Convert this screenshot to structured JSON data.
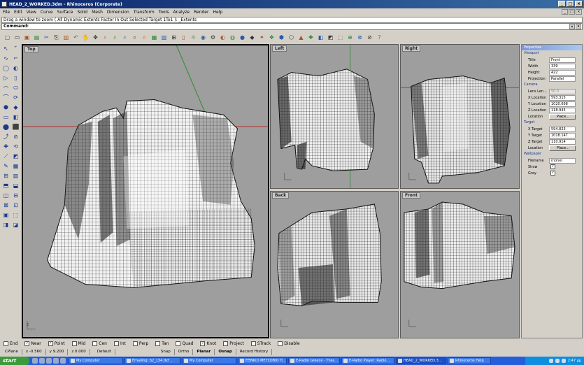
{
  "window": {
    "title": "HEAD_2_WORKED.3dm - Rhinoceros (Corporate)"
  },
  "menus": [
    "File",
    "Edit",
    "View",
    "Curve",
    "Surface",
    "Solid",
    "Mesh",
    "Dimension",
    "Transform",
    "Tools",
    "Analyze",
    "Render",
    "Help"
  ],
  "history": "Drag a window to zoom ( All  Dynamic  Extents  Factor  In  Out  Selected  Target  1To1 ): _Extents",
  "command": {
    "label": "Command:"
  },
  "viewports": {
    "top": "Top",
    "left": "Left",
    "right": "Right",
    "back": "Back",
    "front": "Front"
  },
  "properties": {
    "title": "Properties",
    "viewport_section": "Viewport",
    "title_label": "Title",
    "title_value": "Front",
    "width_label": "Width",
    "width_value": "339",
    "height_label": "Height",
    "height_value": "422",
    "projection_label": "Projection",
    "projection_value": "Parallel",
    "camera_section": "Camera",
    "lens_label": "Lens Len...",
    "lens_value": "50.0",
    "xloc_label": "X Location",
    "xloc_value": "593.315",
    "yloc_label": "Y Location",
    "yloc_value": "1020.698",
    "zloc_label": "Z Location",
    "zloc_value": "118.945",
    "loc_label": "Location",
    "place_label": "Place...",
    "target_section": "Target",
    "xt_label": "X Target",
    "xt_value": "594.823",
    "yt_label": "Y Target",
    "yt_value": "1018.147",
    "zt_label": "Z Target",
    "zt_value": "110.914",
    "tloc_label": "Location",
    "tplace_label": "Place...",
    "wallpaper_section": "Wallpaper",
    "file_label": "Filename",
    "file_value": "(none)",
    "show_label": "Show",
    "gray_label": "Gray"
  },
  "osnaps": [
    {
      "label": "End",
      "checked": false
    },
    {
      "label": "Near",
      "checked": true
    },
    {
      "label": "Point",
      "checked": true
    },
    {
      "label": "Mid",
      "checked": false
    },
    {
      "label": "Cen",
      "checked": false
    },
    {
      "label": "Int",
      "checked": false
    },
    {
      "label": "Perp",
      "checked": false
    },
    {
      "label": "Tan",
      "checked": false
    },
    {
      "label": "Quad",
      "checked": false
    },
    {
      "label": "Knot",
      "checked": true
    },
    {
      "label": "Project",
      "checked": false
    },
    {
      "label": "STrack",
      "checked": false
    },
    {
      "label": "Disable",
      "checked": false
    }
  ],
  "status": {
    "cplane": "CPlane",
    "x": "x -0.560",
    "y": "y 9.200",
    "z": "z 0.000",
    "layer": "Default",
    "snap": "Snap",
    "ortho": "Ortho",
    "planar": "Planar",
    "osnap": "Osnap",
    "record": "Record History"
  },
  "taskbar": {
    "start": "start",
    "tasks": [
      "My Computer",
      "Emailing: b2_134.dxf ...",
      "My Computer",
      "ΕΘΝΙΚΟ ΜΕΤΣΟΒΙΟ Π...",
      "E-Radio Greece - Thes...",
      "E-Radio Player: Radio ...",
      "HEAD_2_WORKED.3...",
      "Rhinoceros Help"
    ],
    "clock": "2:47 μμ"
  },
  "colors": {
    "viewport_bg": "#9e9e9e",
    "title_gradient_start": "#0a246a",
    "taskbar": "#245edb",
    "x_axis": "#b03030",
    "y_axis": "#2f8a2f"
  },
  "icons": {
    "checkmark": "✓"
  }
}
